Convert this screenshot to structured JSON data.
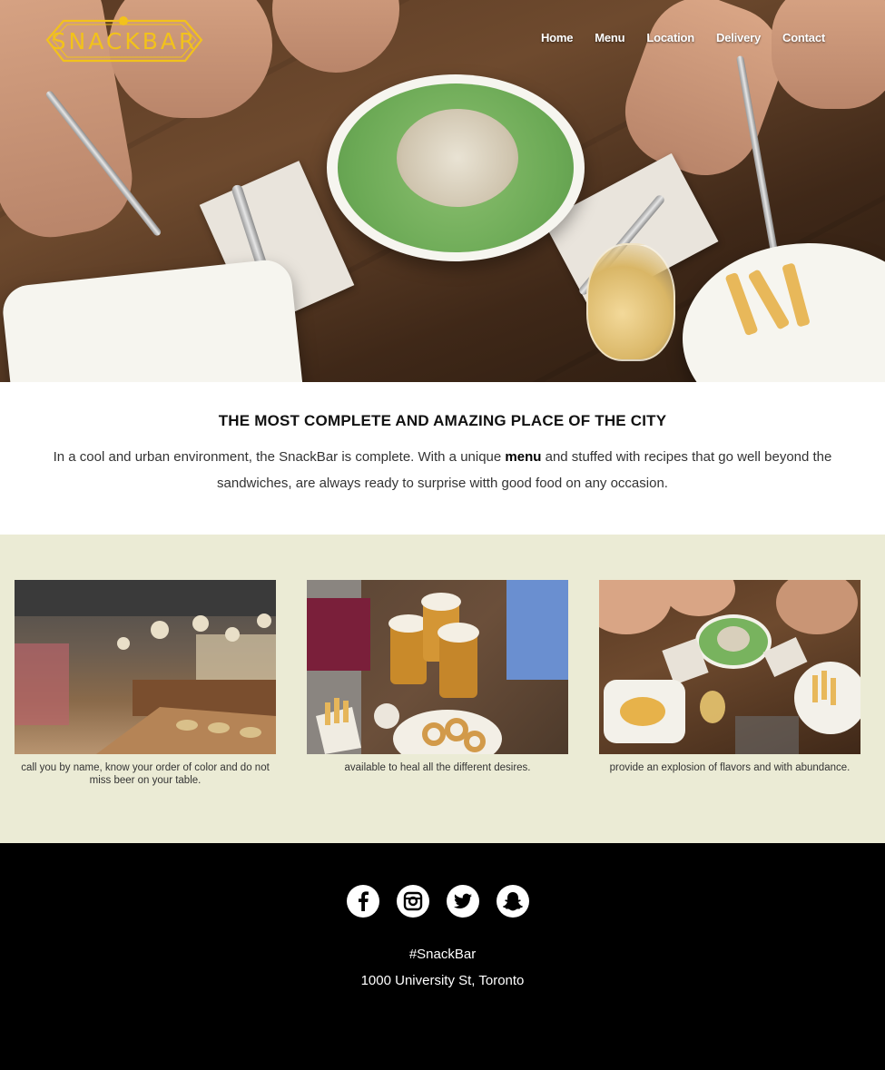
{
  "brand": {
    "logo_text": "SNACKBAR",
    "logo_color": "#f2c21b"
  },
  "nav": {
    "items": [
      {
        "label": "Home"
      },
      {
        "label": "Menu"
      },
      {
        "label": "Location"
      },
      {
        "label": "Delivery"
      },
      {
        "label": "Contact"
      }
    ]
  },
  "intro": {
    "heading": "THE MOST COMPLETE AND AMAZING PLACE OF THE CITY",
    "text_before": "In a cool and urban environment, the SnackBar is complete. With a unique ",
    "text_bold": "menu",
    "text_after": " and stuffed with recipes that go well beyond the sandwiches, are always ready to surprise witth good food on any occasion."
  },
  "gallery": {
    "background": "#ebebd5",
    "cards": [
      {
        "caption": "call you by name, know your order of color and do not miss beer on your table.",
        "image": "restaurant-interior"
      },
      {
        "caption": "available to heal all the different desires.",
        "image": "beer-toast"
      },
      {
        "caption": "provide an explosion of flavors and with abundance.",
        "image": "food-table"
      }
    ]
  },
  "footer": {
    "social": [
      {
        "icon": "facebook-icon"
      },
      {
        "icon": "instagram-icon"
      },
      {
        "icon": "twitter-icon"
      },
      {
        "icon": "snapchat-icon"
      }
    ],
    "hashtag": "#SnackBar",
    "address": "1000 University St, Toronto"
  }
}
